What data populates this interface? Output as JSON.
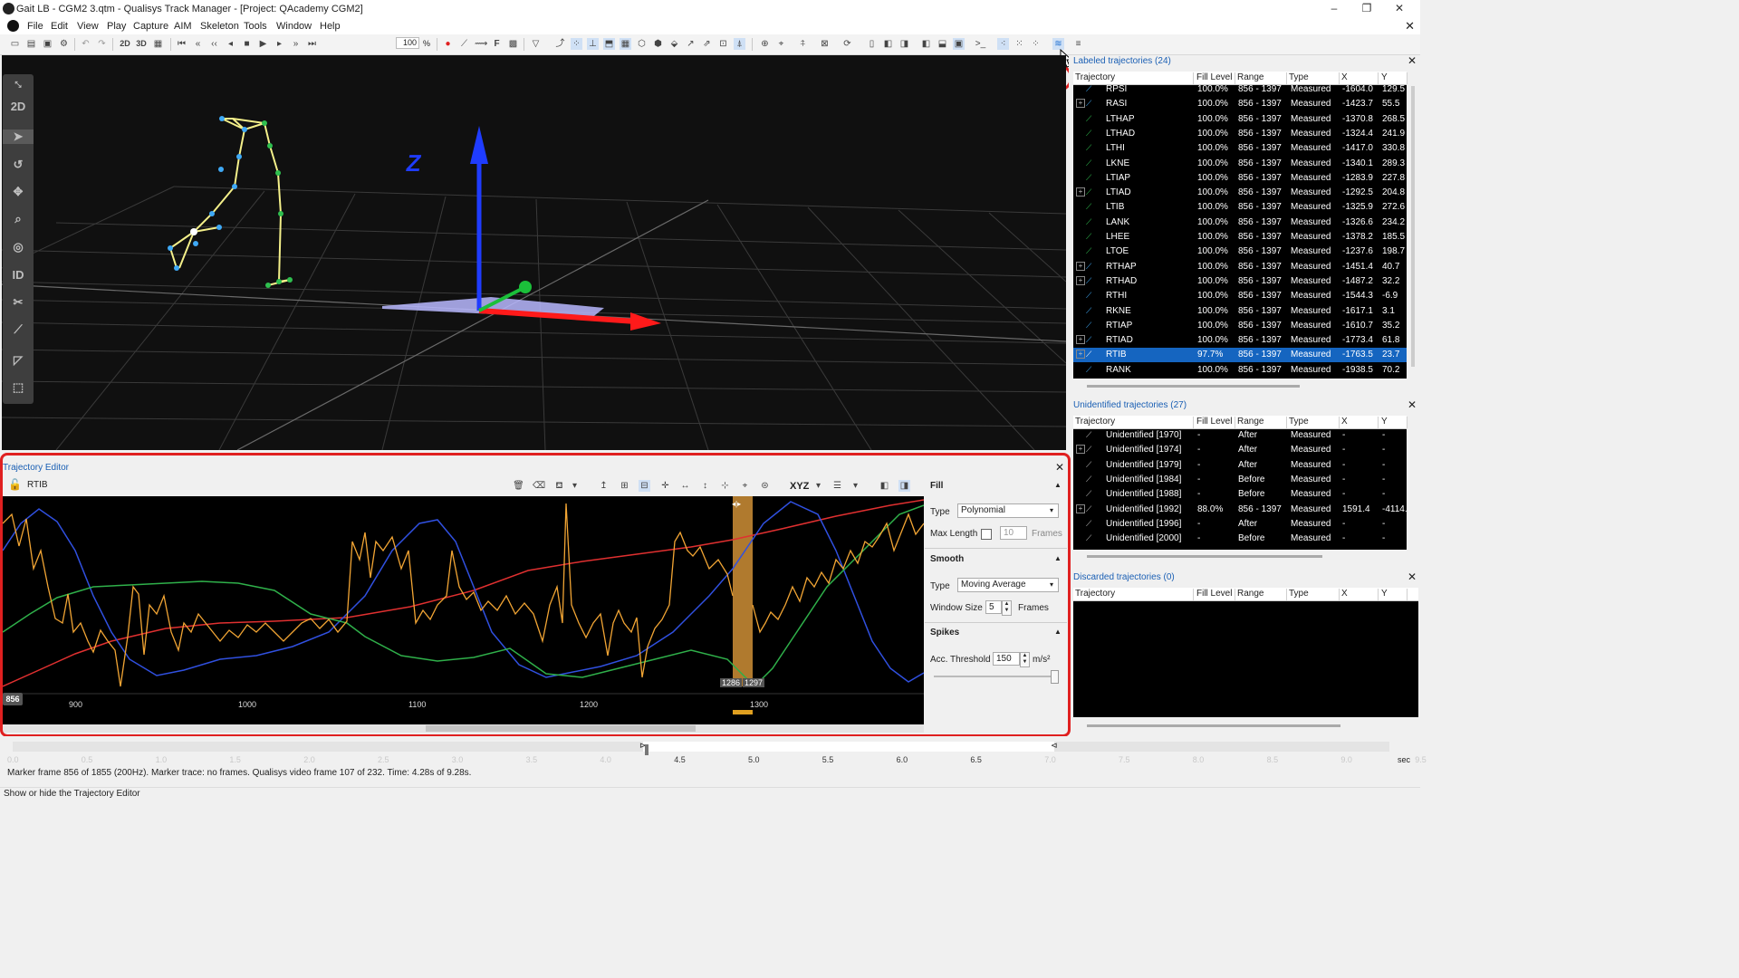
{
  "window": {
    "title": "Gait LB - CGM2 3.qtm - Qualisys Track Manager - [Project: QAcademy CGM2]"
  },
  "menu": [
    "File",
    "Edit",
    "View",
    "Play",
    "Capture",
    "AIM",
    "Skeleton",
    "Tools",
    "Window",
    "Help"
  ],
  "toolbar": {
    "speed_value": "100",
    "speed_unit": "%",
    "view_2d": "2D",
    "view_3d": "3D",
    "f_label": "F",
    "xyz_label": "XYZ"
  },
  "left_tools": {
    "label_2d": "2D",
    "label_id": "ID"
  },
  "labeled": {
    "title": "Labeled trajectories (24)",
    "columns": [
      "Trajectory",
      "Fill Level",
      "Range",
      "Type",
      "X",
      "Y"
    ],
    "rows": [
      {
        "name": "RPSI",
        "fill": "100.0%",
        "range": "856 - 1397",
        "type": "Measured",
        "x": "-1604.0",
        "y": "129.5",
        "exp": false,
        "color": "#3fa9f5"
      },
      {
        "name": "RASI",
        "fill": "100.0%",
        "range": "856 - 1397",
        "type": "Measured",
        "x": "-1423.7",
        "y": "55.5",
        "exp": true,
        "color": "#3fa9f5"
      },
      {
        "name": "LTHAP",
        "fill": "100.0%",
        "range": "856 - 1397",
        "type": "Measured",
        "x": "-1370.8",
        "y": "268.5",
        "exp": false,
        "color": "#2fbf4f"
      },
      {
        "name": "LTHAD",
        "fill": "100.0%",
        "range": "856 - 1397",
        "type": "Measured",
        "x": "-1324.4",
        "y": "241.9",
        "exp": false,
        "color": "#2fbf4f"
      },
      {
        "name": "LTHI",
        "fill": "100.0%",
        "range": "856 - 1397",
        "type": "Measured",
        "x": "-1417.0",
        "y": "330.8",
        "exp": false,
        "color": "#2fbf4f"
      },
      {
        "name": "LKNE",
        "fill": "100.0%",
        "range": "856 - 1397",
        "type": "Measured",
        "x": "-1340.1",
        "y": "289.3",
        "exp": false,
        "color": "#2fbf4f"
      },
      {
        "name": "LTIAP",
        "fill": "100.0%",
        "range": "856 - 1397",
        "type": "Measured",
        "x": "-1283.9",
        "y": "227.8",
        "exp": false,
        "color": "#2fbf4f"
      },
      {
        "name": "LTIAD",
        "fill": "100.0%",
        "range": "856 - 1397",
        "type": "Measured",
        "x": "-1292.5",
        "y": "204.8",
        "exp": true,
        "color": "#2fbf4f"
      },
      {
        "name": "LTIB",
        "fill": "100.0%",
        "range": "856 - 1397",
        "type": "Measured",
        "x": "-1325.9",
        "y": "272.6",
        "exp": false,
        "color": "#2fbf4f"
      },
      {
        "name": "LANK",
        "fill": "100.0%",
        "range": "856 - 1397",
        "type": "Measured",
        "x": "-1326.6",
        "y": "234.2",
        "exp": false,
        "color": "#2fbf4f"
      },
      {
        "name": "LHEE",
        "fill": "100.0%",
        "range": "856 - 1397",
        "type": "Measured",
        "x": "-1378.2",
        "y": "185.5",
        "exp": false,
        "color": "#2fbf4f"
      },
      {
        "name": "LTOE",
        "fill": "100.0%",
        "range": "856 - 1397",
        "type": "Measured",
        "x": "-1237.6",
        "y": "198.7",
        "exp": false,
        "color": "#2fbf4f"
      },
      {
        "name": "RTHAP",
        "fill": "100.0%",
        "range": "856 - 1397",
        "type": "Measured",
        "x": "-1451.4",
        "y": "40.7",
        "exp": true,
        "color": "#3fa9f5"
      },
      {
        "name": "RTHAD",
        "fill": "100.0%",
        "range": "856 - 1397",
        "type": "Measured",
        "x": "-1487.2",
        "y": "32.2",
        "exp": true,
        "color": "#3fa9f5"
      },
      {
        "name": "RTHI",
        "fill": "100.0%",
        "range": "856 - 1397",
        "type": "Measured",
        "x": "-1544.3",
        "y": "-6.9",
        "exp": false,
        "color": "#3fa9f5"
      },
      {
        "name": "RKNE",
        "fill": "100.0%",
        "range": "856 - 1397",
        "type": "Measured",
        "x": "-1617.1",
        "y": "3.1",
        "exp": false,
        "color": "#3fa9f5"
      },
      {
        "name": "RTIAP",
        "fill": "100.0%",
        "range": "856 - 1397",
        "type": "Measured",
        "x": "-1610.7",
        "y": "35.2",
        "exp": false,
        "color": "#3fa9f5"
      },
      {
        "name": "RTIAD",
        "fill": "100.0%",
        "range": "856 - 1397",
        "type": "Measured",
        "x": "-1773.4",
        "y": "61.8",
        "exp": true,
        "color": "#3fa9f5"
      },
      {
        "name": "RTIB",
        "fill": "97.7%",
        "range": "856 - 1397",
        "type": "Measured",
        "x": "-1763.5",
        "y": "23.7",
        "exp": true,
        "color": "#ffffff",
        "selected": true
      },
      {
        "name": "RANK",
        "fill": "100.0%",
        "range": "856 - 1397",
        "type": "Measured",
        "x": "-1938.5",
        "y": "70.2",
        "exp": false,
        "color": "#3fa9f5"
      }
    ]
  },
  "unidentified": {
    "title": "Unidentified trajectories (27)",
    "columns": [
      "Trajectory",
      "Fill Level",
      "Range",
      "Type",
      "X",
      "Y"
    ],
    "rows": [
      {
        "name": "Unidentified [1970]",
        "fill": "-",
        "range": "After",
        "type": "Measured",
        "x": "-",
        "y": "-",
        "exp": false
      },
      {
        "name": "Unidentified [1974]",
        "fill": "-",
        "range": "After",
        "type": "Measured",
        "x": "-",
        "y": "-",
        "exp": true
      },
      {
        "name": "Unidentified [1979]",
        "fill": "-",
        "range": "After",
        "type": "Measured",
        "x": "-",
        "y": "-",
        "exp": false
      },
      {
        "name": "Unidentified [1984]",
        "fill": "-",
        "range": "Before",
        "type": "Measured",
        "x": "-",
        "y": "-",
        "exp": false
      },
      {
        "name": "Unidentified [1988]",
        "fill": "-",
        "range": "Before",
        "type": "Measured",
        "x": "-",
        "y": "-",
        "exp": false
      },
      {
        "name": "Unidentified [1992]",
        "fill": "88.0%",
        "range": "856 - 1397",
        "type": "Measured",
        "x": "1591.4",
        "y": "-4114.",
        "exp": true
      },
      {
        "name": "Unidentified [1996]",
        "fill": "-",
        "range": "After",
        "type": "Measured",
        "x": "-",
        "y": "-",
        "exp": false
      },
      {
        "name": "Unidentified [2000]",
        "fill": "-",
        "range": "Before",
        "type": "Measured",
        "x": "-",
        "y": "-",
        "exp": false
      }
    ]
  },
  "discarded": {
    "title": "Discarded trajectories (0)",
    "columns": [
      "Trajectory",
      "Fill Level",
      "Range",
      "Type",
      "X",
      "Y"
    ]
  },
  "traj_editor": {
    "title": "Trajectory Editor",
    "marker": "RTIB",
    "frame_badge": "856",
    "x_ticks": [
      "900",
      "1000",
      "1100",
      "1200",
      "1300"
    ],
    "gap_start": "1286",
    "gap_end": "1297",
    "fill": {
      "title": "Fill",
      "type_label": "Type",
      "type_value": "Polynomial",
      "maxlen_label": "Max Length",
      "maxlen_value": "10",
      "frames": "Frames"
    },
    "smooth": {
      "title": "Smooth",
      "type_label": "Type",
      "type_value": "Moving Average",
      "window_label": "Window Size",
      "window_value": "5",
      "frames": "Frames"
    },
    "spikes": {
      "title": "Spikes",
      "acc_label": "Acc. Threshold",
      "acc_value": "150",
      "unit": "m/s²"
    }
  },
  "timeline": {
    "ticks": [
      "0.0",
      "0.5",
      "1.0",
      "1.5",
      "2.0",
      "2.5",
      "3.0",
      "3.5",
      "4.0",
      "4.5",
      "5.0",
      "5.5",
      "6.0",
      "6.5",
      "7.0",
      "7.5",
      "8.0",
      "8.5",
      "9.0",
      "9.5"
    ],
    "unit": "sec"
  },
  "status": {
    "line": "Marker frame 856 of 1855 (200Hz). Marker trace: no frames. Qualisys video frame 107 of 232. Time: 4.28s of 9.28s.",
    "tooltip": "Show or hide the Trajectory Editor"
  }
}
